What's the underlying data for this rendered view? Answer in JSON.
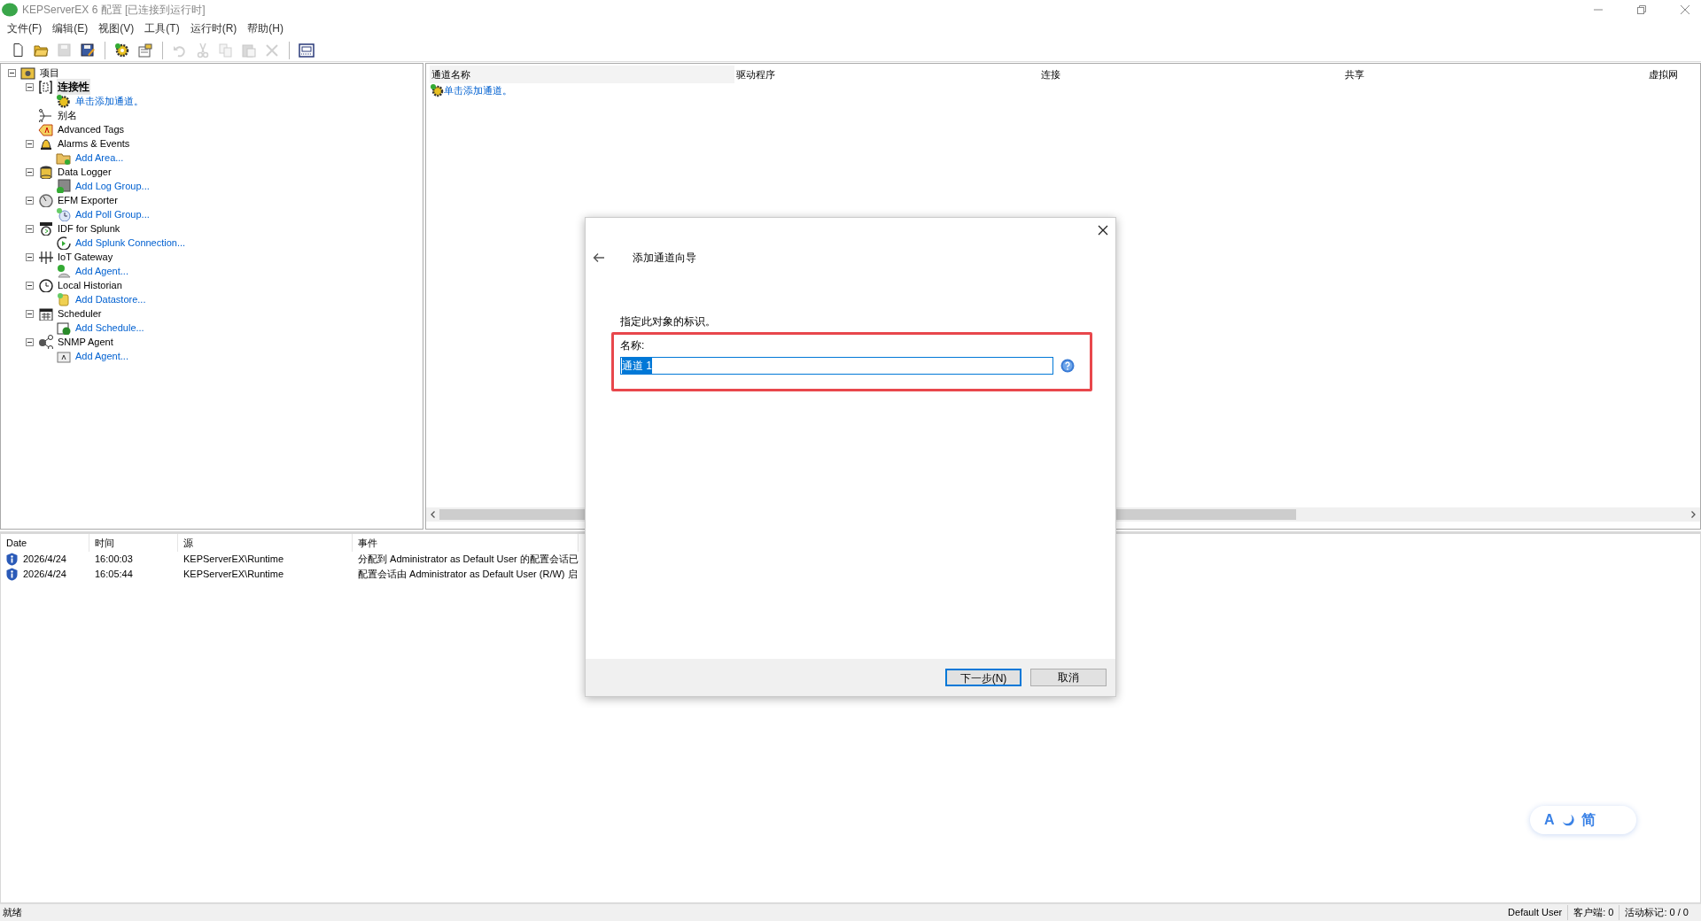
{
  "window": {
    "title": "KEPServerEX 6 配置 [已连接到运行时]"
  },
  "menu": [
    "文件(F)",
    "编辑(E)",
    "视图(V)",
    "工具(T)",
    "运行时(R)",
    "帮助(H)"
  ],
  "toolbar": [
    {
      "disabled": false
    },
    {
      "disabled": false
    },
    {
      "disabled": true
    },
    {
      "disabled": false
    },
    {
      "kind": "sep"
    },
    {
      "disabled": false
    },
    {
      "disabled": false
    },
    {
      "kind": "sep"
    },
    {
      "disabled": true
    },
    {
      "disabled": true
    },
    {
      "disabled": true
    },
    {
      "disabled": true
    },
    {
      "disabled": true
    },
    {
      "kind": "sep"
    },
    {
      "disabled": false
    }
  ],
  "tree": [
    {
      "label": "项目",
      "expanded": true,
      "selected": false,
      "children": [
        {
          "label": "连接性",
          "expanded": true,
          "selected": true,
          "children": [
            {
              "label": "单击添加通道。",
              "kind": "action",
              "selected": false
            }
          ]
        },
        {
          "label": "别名",
          "selected": false
        },
        {
          "label": "Advanced Tags",
          "selected": false
        },
        {
          "label": "Alarms & Events",
          "expanded": true,
          "selected": false,
          "children": [
            {
              "label": "Add Area...",
              "kind": "action",
              "selected": false
            }
          ]
        },
        {
          "label": "Data Logger",
          "expanded": true,
          "selected": false,
          "children": [
            {
              "label": "Add Log Group...",
              "kind": "action",
              "selected": false
            }
          ]
        },
        {
          "label": "EFM Exporter",
          "expanded": true,
          "selected": false,
          "children": [
            {
              "label": "Add Poll Group...",
              "kind": "action",
              "selected": false
            }
          ]
        },
        {
          "label": "IDF for Splunk",
          "expanded": true,
          "selected": false,
          "children": [
            {
              "label": "Add Splunk Connection...",
              "kind": "action",
              "selected": false
            }
          ]
        },
        {
          "label": "IoT Gateway",
          "expanded": true,
          "selected": false,
          "children": [
            {
              "label": "Add Agent...",
              "kind": "action",
              "selected": false
            }
          ]
        },
        {
          "label": "Local Historian",
          "expanded": true,
          "selected": false,
          "children": [
            {
              "label": "Add Datastore...",
              "kind": "action",
              "selected": false
            }
          ]
        },
        {
          "label": "Scheduler",
          "expanded": true,
          "selected": false,
          "children": [
            {
              "label": "Add Schedule...",
              "kind": "action",
              "selected": false
            }
          ]
        },
        {
          "label": "SNMP Agent",
          "expanded": true,
          "selected": false,
          "children": [
            {
              "label": "Add Agent...",
              "kind": "action",
              "selected": false
            }
          ]
        }
      ]
    }
  ],
  "channel_table": {
    "columns": [
      "通道名称",
      "驱动程序",
      "连接",
      "共享",
      "虚拟网"
    ],
    "rows": [
      {
        "label": "单击添加通道。",
        "kind": "action"
      }
    ]
  },
  "event_log": {
    "columns": [
      "Date",
      "时间",
      "源",
      "事件"
    ],
    "rows": [
      {
        "date": "2026/4/24",
        "time": "16:00:03",
        "source": "KEPServerEX\\Runtime",
        "event": "分配到 Administrator as Default User 的配置会话已"
      },
      {
        "date": "2026/4/24",
        "time": "16:05:44",
        "source": "KEPServerEX\\Runtime",
        "event": "配置会话由 Administrator as Default User (R/W) 启"
      }
    ]
  },
  "dialog": {
    "title": "添加通道向导",
    "instruction": "指定此对象的标识。",
    "field_label": "名称:",
    "field_value": "通道 1",
    "value_selected": true,
    "highlighted": true,
    "buttons": [
      {
        "label": "下一步(N)",
        "default": true
      },
      {
        "label": "取消",
        "default": false
      }
    ]
  },
  "ime_indicator": {
    "mode": "A",
    "script": "简"
  },
  "status_bar": {
    "left": "就绪",
    "user": "Default User",
    "clients": "客户端: 0",
    "tags": "活动标记: 0 / 0"
  }
}
